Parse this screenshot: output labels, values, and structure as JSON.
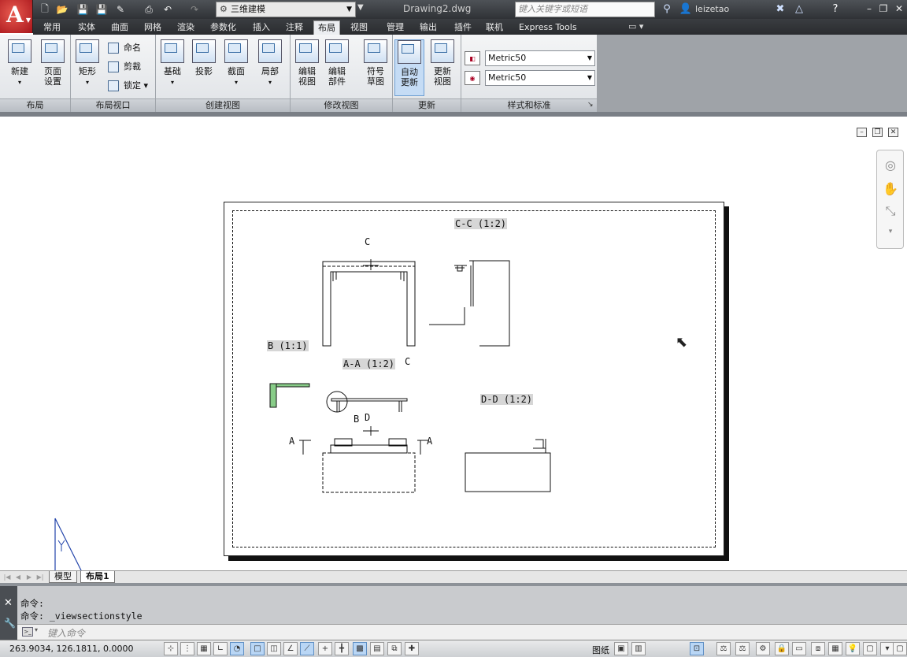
{
  "titlebar": {
    "workspace": "三维建模",
    "document_title": "Drawing2.dwg",
    "search_placeholder": "键入关键字或短语",
    "username": "leizetao"
  },
  "tabs": [
    "常用",
    "实体",
    "曲面",
    "网格",
    "渲染",
    "参数化",
    "插入",
    "注释",
    "布局",
    "视图",
    "管理",
    "输出",
    "插件",
    "联机",
    "Express Tools"
  ],
  "active_tab": "布局",
  "ribbon": {
    "layout_panel": {
      "title": "布局",
      "new": "新建",
      "page_setup_1": "页面",
      "page_setup_2": "设置"
    },
    "viewport_panel": {
      "title": "布局视口",
      "rect": "矩形",
      "name": "命名",
      "clip": "剪裁",
      "lock": "锁定"
    },
    "create_view_panel": {
      "title": "创建视图",
      "base": "基础",
      "projected": "投影",
      "section": "截面",
      "detail": "局部"
    },
    "modify_view_panel": {
      "title": "修改视图",
      "edit_view_1": "编辑",
      "edit_view_2": "视图",
      "edit_comp_1": "编辑",
      "edit_comp_2": "部件",
      "symbol_1": "符号",
      "symbol_2": "草图"
    },
    "update_panel": {
      "title": "更新",
      "auto_1": "自动",
      "auto_2": "更新",
      "upd_1": "更新",
      "upd_2": "视图"
    },
    "styles_panel": {
      "title": "样式和标准",
      "style1": "Metric50",
      "style2": "Metric50"
    }
  },
  "drawing": {
    "label_cc": "C-C (1:2)",
    "label_b": "B (1:1)",
    "label_aa": "A-A (1:2)",
    "label_dd": "D-D (1:2)",
    "marker_c_top": "C",
    "marker_c_bottom": "C",
    "marker_b": "B",
    "marker_d": "D",
    "marker_a_left": "A",
    "marker_a_right": "A"
  },
  "layout_tabs": {
    "model": "模型",
    "layout1": "布局1"
  },
  "command": {
    "line1": "命令:",
    "line2": "命令: _viewsectionstyle",
    "placeholder": "键入命令"
  },
  "status": {
    "coords": "263.9034, 126.1811, 0.0000",
    "paper": "图纸"
  }
}
